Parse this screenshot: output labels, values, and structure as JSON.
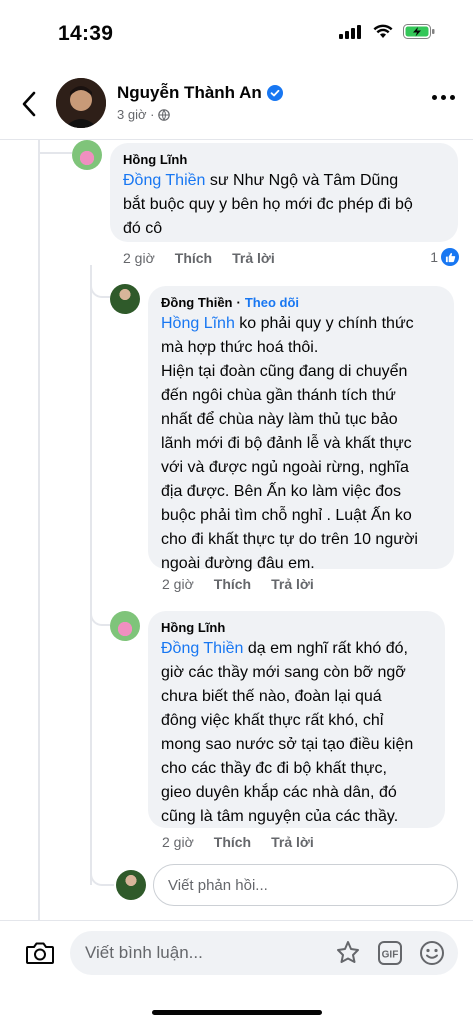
{
  "status_bar": {
    "time": "14:39"
  },
  "header": {
    "name": "Nguyễn Thành An",
    "meta": "3 giờ ·"
  },
  "comments": [
    {
      "author": "Hồng Lĩnh",
      "mention": "Đồng Thiền",
      "text": " sư Như Ngộ và Tâm Dũng\nbắt buộc quy y bên họ mới đc phép đi bộ\nđó cô",
      "time": "2 giờ",
      "like_label": "Thích",
      "reply_label": "Trả lời",
      "like_count": "1"
    },
    {
      "author": "Đồng Thiền",
      "separator": "·",
      "follow_label": "Theo dõi",
      "mention": "Hồng Lĩnh",
      "text": " ko phải quy y chính thức\nmà hợp thức hoá thôi.\nHiện tại đoàn cũng đang di chuyển\nđến ngôi chùa gần thánh tích thứ\nnhất để chùa này làm thủ tục bảo\nlãnh mới đi bộ đảnh lễ và khất thực\nvới và được ngủ ngoài rừng, nghĩa\nđịa được. Bên Ấn ko làm việc đos\nbuộc phải tìm chỗ nghỉ . Luật Ấn ko\ncho đi khất thực tự do trên 10 người\nngoài đường đâu em.",
      "time": "2 giờ",
      "like_label": "Thích",
      "reply_label": "Trả lời"
    },
    {
      "author": "Hồng Lĩnh",
      "mention": "Đồng Thiền",
      "text": " dạ em nghĩ rất khó đó,\ngiờ các thầy mới sang còn bỡ ngỡ\nchưa biết thế nào, đoàn lại quá\nđông việc khất thực rất khó, chỉ\nmong sao nước sở tại tạo điều kiện\ncho các thầy đc đi bộ khất thực,\ngieo duyên khắp các nhà dân, đó\ncũng là tâm nguyện của các thầy.",
      "time": "2 giờ",
      "like_label": "Thích",
      "reply_label": "Trả lời"
    }
  ],
  "reply_input": {
    "placeholder": "Viết phản hồi..."
  },
  "comment_input": {
    "placeholder": "Viết bình luận..."
  },
  "colors": {
    "accent": "#1877f2",
    "bubble": "#f0f2f5",
    "secondary_text": "#65676b"
  },
  "icons": [
    "back-icon",
    "verified-icon",
    "globe-icon",
    "more-icon",
    "like-icon",
    "camera-icon",
    "sticker-icon",
    "gif-icon",
    "emoji-icon"
  ]
}
